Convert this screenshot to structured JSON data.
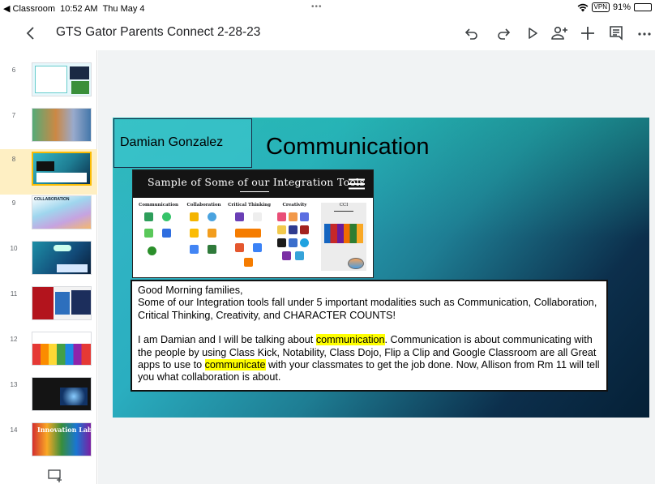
{
  "status_bar": {
    "back_app": "◀ Classroom",
    "time": "10:52 AM",
    "date": "Thu May 4",
    "vpn": "VPN",
    "battery": "91%",
    "battery_level": 0.91
  },
  "toolbar": {
    "title": "GTS Gator Parents Connect 2-28-23",
    "buttons": [
      "undo-icon",
      "redo-icon",
      "play-icon",
      "add-person-icon",
      "plus-icon",
      "comments-icon",
      "more-icon"
    ]
  },
  "filmstrip": {
    "selected": "8",
    "slides": [
      {
        "num": "6"
      },
      {
        "num": "7"
      },
      {
        "num": "8"
      },
      {
        "num": "9"
      },
      {
        "num": "10"
      },
      {
        "num": "11"
      },
      {
        "num": "12"
      },
      {
        "num": "13"
      },
      {
        "num": "14"
      }
    ],
    "thumb_14_text": "Innovation Labs",
    "thumb_9_text": "COLLABORATION"
  },
  "slide": {
    "presenter": "Damian Gonzalez",
    "title": "Communication",
    "tools_image": {
      "header": "Sample of Some of our Integration Tools",
      "columns": [
        "Communication",
        "Collaboration",
        "Critical Thinking",
        "Creativity",
        "CCI"
      ]
    },
    "text": {
      "line1": "Good Morning families,",
      "line2": "Some of our Integration tools fall under 5 important modalities such as Communication, Collaboration, Critical Thinking, Creativity, and CHARACTER COUNTS!",
      "p2_a": "I am Damian and I will be talking about ",
      "p2_hl1": "communication",
      "p2_b": ". Communication is about communicating with the people by using Class Kick, Notability, Class Dojo, Flip a Clip and Google Classroom are all Great apps to use to ",
      "p2_hl2": "communicate",
      "p2_c": " with your classmates to get the job done. Now, Allison from Rm 11 will tell you what collaboration is about."
    }
  },
  "colors": {
    "selected_thumb_bg": "#feefc3",
    "selected_thumb_border": "#fbbc04",
    "highlight": "#ffff00"
  }
}
